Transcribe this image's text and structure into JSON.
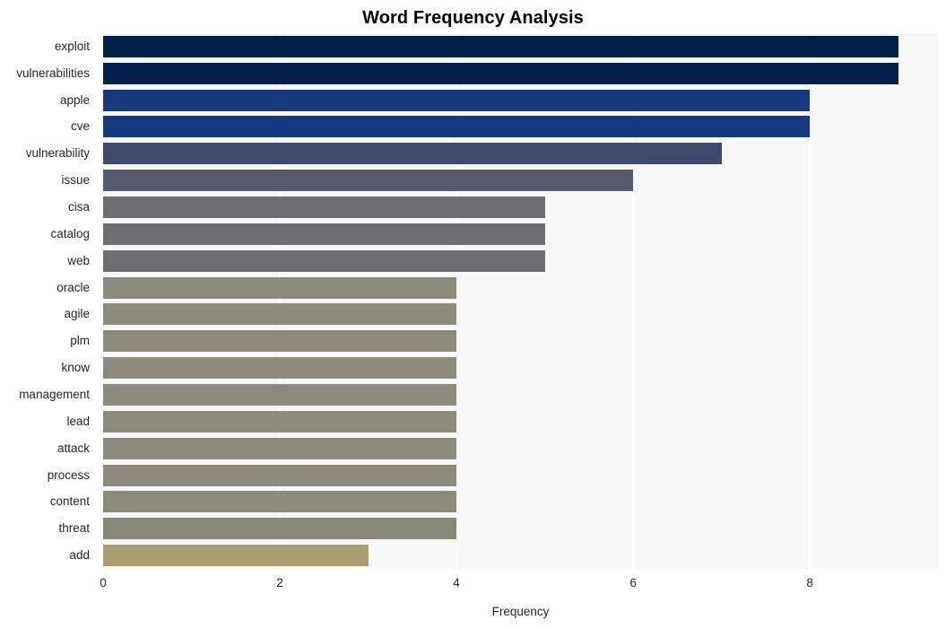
{
  "chart_data": {
    "type": "bar",
    "orientation": "horizontal",
    "title": "Word Frequency Analysis",
    "xlabel": "Frequency",
    "ylabel": "",
    "xlim": [
      0,
      9.45
    ],
    "xticks": [
      0,
      2,
      4,
      6,
      8
    ],
    "xtick_labels": [
      "0",
      "2",
      "4",
      "6",
      "8"
    ],
    "grid": "vertical-only",
    "legend": "none",
    "categories": [
      "exploit",
      "vulnerabilities",
      "apple",
      "cve",
      "vulnerability",
      "issue",
      "cisa",
      "catalog",
      "web",
      "oracle",
      "agile",
      "plm",
      "know",
      "management",
      "lead",
      "attack",
      "process",
      "content",
      "threat",
      "add"
    ],
    "values": [
      9,
      9,
      8,
      8,
      7,
      6,
      5,
      5,
      5,
      4,
      4,
      4,
      4,
      4,
      4,
      4,
      4,
      4,
      4,
      3
    ],
    "bar_colors": [
      "#03204c",
      "#03204c",
      "#163a7d",
      "#163a7d",
      "#3e4a6e",
      "#545a6b",
      "#6e6e70",
      "#6e6e70",
      "#6e6e70",
      "#8d8a7c",
      "#8d8a7c",
      "#8d8a7c",
      "#8d8a7c",
      "#8d8a7c",
      "#8d8a7c",
      "#8d8a7c",
      "#8d8a7c",
      "#8d8a7c",
      "#8a8678",
      "#a89d6d"
    ]
  },
  "style": {
    "plot_background": "#f7f7f7",
    "gridline_color": "#ffffff",
    "page_background": "#ffffff",
    "text_color": "#262626",
    "title_color": "#000000"
  }
}
